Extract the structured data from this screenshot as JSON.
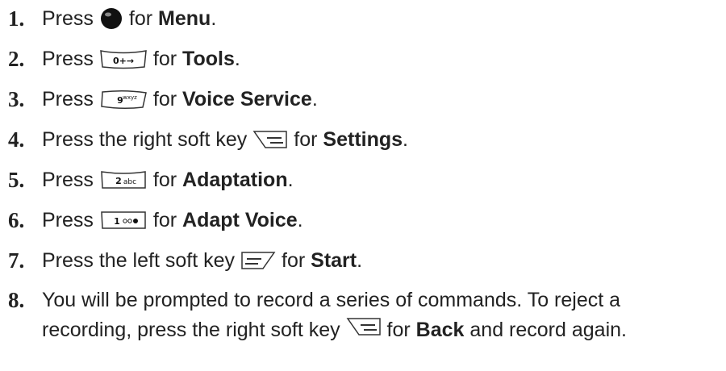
{
  "steps": [
    {
      "num": "1.",
      "before": "Press",
      "key": "center-key",
      "after": "for",
      "term": "Menu",
      "end": "."
    },
    {
      "num": "2.",
      "before": "Press",
      "key": "0-key",
      "key_label": "0+→",
      "after": "for",
      "term": "Tools",
      "end": "."
    },
    {
      "num": "3.",
      "before": "Press",
      "key": "9-key",
      "key_label": "9wxyz",
      "after": "for",
      "term": "Voice Service",
      "end": "."
    },
    {
      "num": "4.",
      "before": "Press the right soft key",
      "key": "right-soft-key",
      "after": "for",
      "term": "Settings",
      "end": "."
    },
    {
      "num": "5.",
      "before": "Press",
      "key": "2-key",
      "key_label": "2abc",
      "after": "for",
      "term": "Adaptation",
      "end": "."
    },
    {
      "num": "6.",
      "before": "Press",
      "key": "1-key",
      "key_label": "1",
      "after": "for",
      "term": "Adapt Voice",
      "end": "."
    },
    {
      "num": "7.",
      "before": "Press the left soft key",
      "key": "left-soft-key",
      "after": "for",
      "term": "Start",
      "end": "."
    },
    {
      "num": "8.",
      "before": "You will be prompted to record a series of commands. To reject a recording, press the right soft key",
      "key": "right-soft-key",
      "after": "for",
      "term": "Back",
      "end": "and record again."
    }
  ]
}
